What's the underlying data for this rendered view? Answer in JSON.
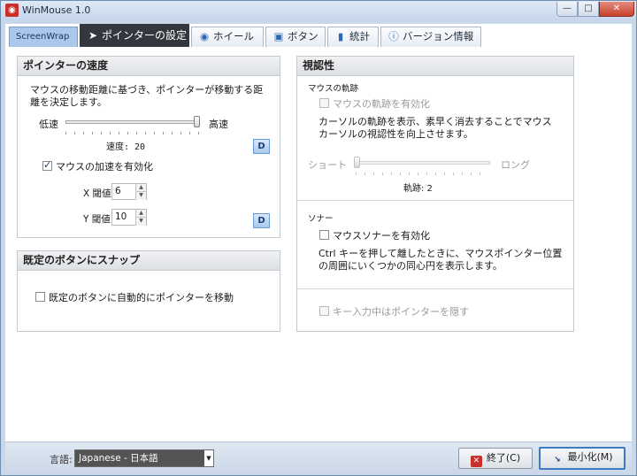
{
  "window": {
    "title": "WinMouse 1.0",
    "app_icon": "mouse-icon",
    "minimize": "—",
    "maximize": "□",
    "close": "✕"
  },
  "tabs": [
    {
      "label": "ScreenWrap",
      "icon": ""
    },
    {
      "label": "ポインターの設定",
      "icon": "pointer-icon",
      "glyph": "➤"
    },
    {
      "label": "ホイール",
      "icon": "wheel-icon",
      "glyph": "◉"
    },
    {
      "label": "ボタン",
      "icon": "button-icon",
      "glyph": "▣"
    },
    {
      "label": "統計",
      "icon": "chart-icon",
      "glyph": "▮"
    },
    {
      "label": "バージョン情報",
      "icon": "info-icon",
      "glyph": "ⓘ"
    }
  ],
  "speed": {
    "header": "ポインターの速度",
    "desc_line1": "マウスの移動距離に基づき、ポインターが移動する距",
    "desc_line2": "離を決定します。",
    "slow": "低速",
    "fast": "高速",
    "speed_label": "速度: 20",
    "speed_value": 20,
    "speed_max": 20,
    "default_btn": "D",
    "accel_label": "マウスの加速を有効化",
    "accel_checked": true,
    "x_label": "X 閾値",
    "x_value": "6",
    "y_label": "Y 閾値",
    "y_value": "10",
    "default_btn2": "D"
  },
  "snap": {
    "header": "既定のボタンにスナップ",
    "label": "既定のボタンに自動的にポインターを移動",
    "checked": false
  },
  "visibility": {
    "header": "視認性",
    "trail_section": "マウスの軌跡",
    "trail_label": "マウスの軌跡を有効化",
    "trail_checked": false,
    "trail_desc1": "カーソルの軌跡を表示、素早く消去することでマウス",
    "trail_desc2": "カーソルの視認性を向上させます。",
    "short": "ショート",
    "long": "ロング",
    "trail_value_label": "軌跡: 2",
    "trail_value": 2,
    "sonar_section": "ソナー",
    "sonar_label": "マウスソナーを有効化",
    "sonar_checked": false,
    "sonar_desc1": "Ctrl キーを押して離したときに、マウスポインター位置",
    "sonar_desc2": "の周囲にいくつかの同心円を表示します。",
    "hide_label": "キー入力中はポインターを隠す",
    "hide_checked": false
  },
  "footer": {
    "lang_label": "言語:",
    "lang_value": "Japanese - 日本語",
    "exit_label": "終了(C)",
    "minimize_label": "最小化(M)"
  }
}
